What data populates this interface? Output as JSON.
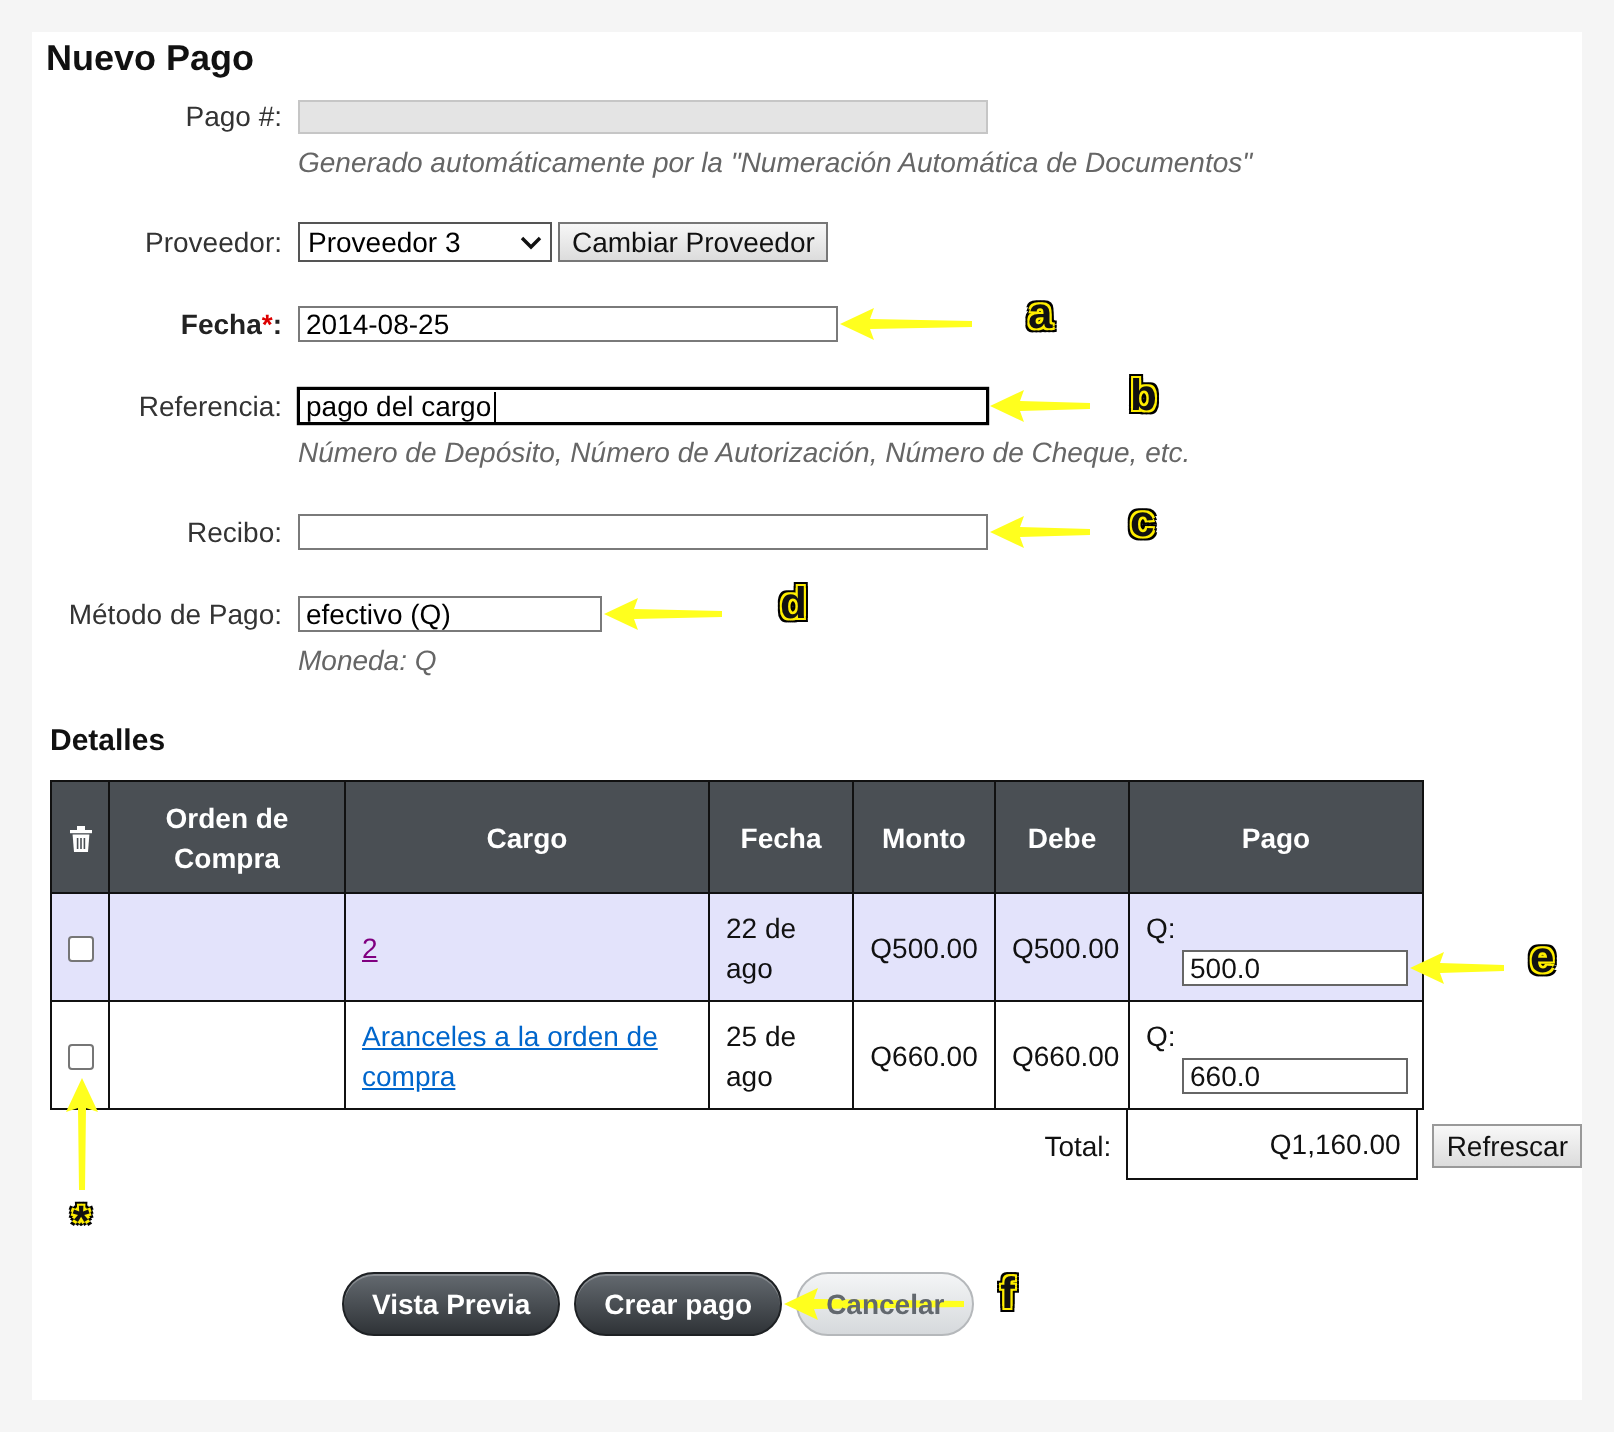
{
  "page": {
    "title": "Nuevo Pago"
  },
  "fields": [
    {
      "kind": "readonly",
      "label": "Pago #:",
      "hint": "Generado automáticamente por la \"Numeración Automática de Documentos\""
    },
    {
      "kind": "select",
      "label": "Proveedor:",
      "value": "Proveedor 3",
      "button": "Cambiar Proveedor"
    },
    {
      "kind": "date",
      "label": "Fecha",
      "required_mark": "*",
      "label_end": ":",
      "value": "2014-08-25",
      "focused": false,
      "annotation": "a"
    },
    {
      "kind": "text",
      "label": "Referencia:",
      "value": "pago del cargo",
      "focused": true,
      "hint": "Número de Depósito, Número de Autorización, Número de Cheque, etc.",
      "annotation": "b"
    },
    {
      "kind": "text",
      "label": "Recibo:",
      "focused": false,
      "annotation": "c"
    },
    {
      "kind": "choice",
      "label": "Método de Pago:",
      "value": "efectivo (Q)",
      "focused": false,
      "hint": "Moneda: Q",
      "annotation": "d"
    }
  ],
  "details": {
    "title": "Detalles",
    "columns": [
      {
        "kind": "icon"
      },
      {
        "kind": "text",
        "label": "Orden de Compra"
      },
      {
        "kind": "text",
        "label": "Cargo"
      },
      {
        "kind": "text",
        "label": "Fecha"
      },
      {
        "kind": "text",
        "label": "Monto"
      },
      {
        "kind": "text",
        "label": "Debe"
      },
      {
        "kind": "text",
        "label": "Pago"
      }
    ],
    "rows": [
      {
        "highlighted": true,
        "checked": false,
        "charge": "2",
        "visited": true,
        "date": "22 de ago",
        "amount": "Q500.00",
        "due": "Q500.00",
        "currency": "Q:",
        "payment": "500.0",
        "payment_annotation": "e"
      },
      {
        "highlighted": false,
        "checked": false,
        "checkbox_annotation": "*",
        "charge": "Aranceles a la orden de compra",
        "visited": false,
        "date": "25 de ago",
        "amount": "Q660.00",
        "due": "Q660.00",
        "currency": "Q:",
        "payment": "660.0"
      }
    ],
    "total": {
      "label": "Total:",
      "value": "Q1,160.00",
      "button": "Refrescar"
    }
  },
  "buttons": [
    {
      "label": "Vista Previa",
      "disabled": false
    },
    {
      "label": "Crear pago",
      "disabled": false,
      "annotation": "f"
    },
    {
      "label": "Cancelar",
      "disabled": true
    }
  ]
}
